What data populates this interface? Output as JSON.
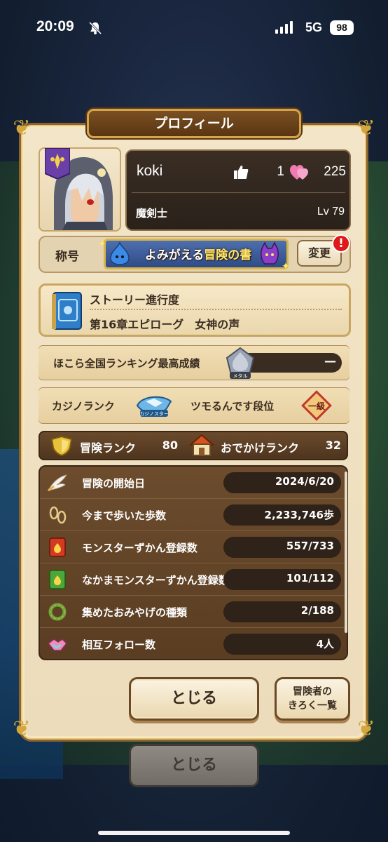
{
  "status_bar": {
    "time": "20:09",
    "network": "5G",
    "battery": "98"
  },
  "panel": {
    "title": "プロフィール"
  },
  "player": {
    "name": "koki",
    "likes": "1",
    "hearts": "225",
    "job": "魔剣士",
    "level": "Lv 79"
  },
  "title_row": {
    "label": "称号",
    "plate_part1": "よみがえる",
    "plate_part2": "冒険の書",
    "change_label": "変更",
    "alert": "!"
  },
  "story": {
    "label": "ストーリー進行度",
    "chapter": "第16章エピローグ　女神の声"
  },
  "ranking": {
    "label": "ほこら全国ランキング最高成績",
    "value": "—",
    "badge": "メタル"
  },
  "casino": {
    "label": "カジノランク",
    "icon_text": "カジノスター",
    "rank_name": "ツモるんです段位",
    "grade_text": "一級"
  },
  "ranks": {
    "adventure_label": "冒険ランク",
    "adventure_value": "80",
    "outing_label": "おでかけランク",
    "outing_value": "32"
  },
  "stats": [
    {
      "label": "冒険の開始日",
      "value": "2024/6/20",
      "icon": "wing-icon"
    },
    {
      "label": "今まで歩いた歩数",
      "value": "2,233,746歩",
      "icon": "footprints-icon"
    },
    {
      "label": "モンスターずかん登録数",
      "value": "557/733",
      "icon": "red-book-icon"
    },
    {
      "label": "なかまモンスターずかん登録数",
      "value": "101/112",
      "icon": "green-book-icon"
    },
    {
      "label": "集めたおみやげの種類",
      "value": "2/188",
      "icon": "wreath-icon"
    },
    {
      "label": "相互フォロー数",
      "value": "4人",
      "icon": "handshake-icon"
    }
  ],
  "buttons": {
    "close": "とじる",
    "records_line1": "冒険者の",
    "records_line2": "きろく一覧",
    "close_back": "とじる"
  },
  "colors": {
    "panel_bg": "#ecdcbb",
    "frame_gold": "#d2a54d",
    "dark_brown": "#5a3d22",
    "alert_red": "#e01818"
  }
}
